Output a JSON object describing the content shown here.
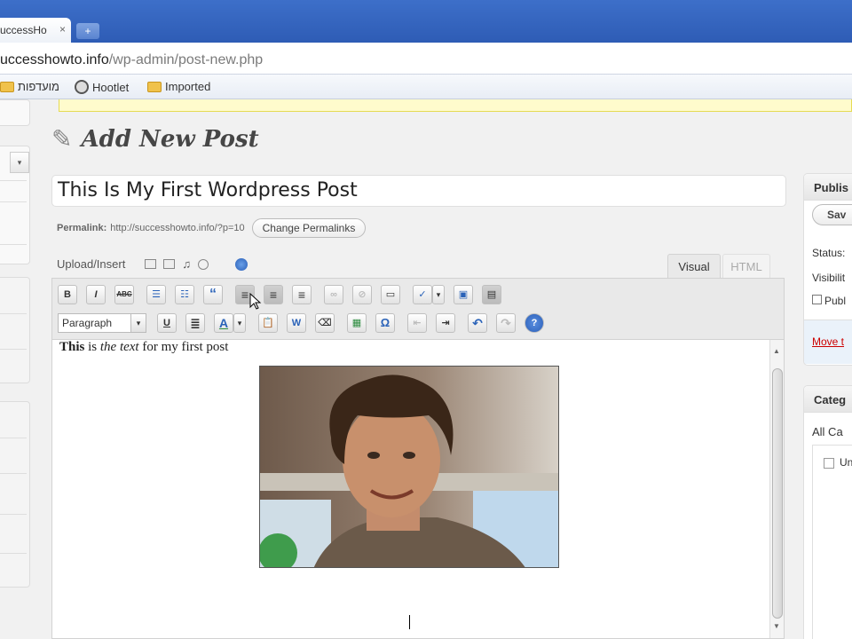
{
  "browser": {
    "tab_title": "uccessHo",
    "tab_close": "×",
    "new_tab": "+",
    "url_host": "uccesshowto.info",
    "url_path": "/wp-admin/post-new.php",
    "bookmarks": [
      {
        "label": "מועדפות",
        "icon": "folder-icon"
      },
      {
        "label": "Hootlet",
        "icon": "globe-icon"
      },
      {
        "label": "Imported",
        "icon": "folder-icon"
      }
    ]
  },
  "page": {
    "title": "Add New Post",
    "post_title_value": "This Is My First Wordpress Post",
    "permalink_label": "Permalink:",
    "permalink_url": "http://successhowto.info/?p=10",
    "change_permalinks": "Change Permalinks",
    "upload_insert": "Upload/Insert"
  },
  "editor": {
    "tab_visual": "Visual",
    "tab_html": "HTML",
    "format_value": "Paragraph",
    "text": {
      "bold": "This",
      "normal1": " is ",
      "italic": "the text",
      "normal2": " for my first post"
    },
    "row1": [
      {
        "id": "bold",
        "glyph": "B"
      },
      {
        "id": "italic",
        "glyph": "I"
      },
      {
        "id": "strikethrough",
        "glyph": "ABC"
      },
      {
        "id": "bullet-list",
        "glyph": "☰"
      },
      {
        "id": "numbered-list",
        "glyph": "☷"
      },
      {
        "id": "blockquote",
        "glyph": "“"
      },
      {
        "id": "align-left",
        "glyph": "≡"
      },
      {
        "id": "align-center",
        "glyph": "≡"
      },
      {
        "id": "align-right",
        "glyph": "≡"
      },
      {
        "id": "insert-link",
        "glyph": "∞"
      },
      {
        "id": "unlink",
        "glyph": "⊘"
      },
      {
        "id": "more-tag",
        "glyph": "▭"
      },
      {
        "id": "spellcheck",
        "glyph": "✓"
      },
      {
        "id": "spellcheck-menu",
        "glyph": "▾"
      },
      {
        "id": "fullscreen",
        "glyph": "▣"
      },
      {
        "id": "kitchen-sink",
        "glyph": "▤"
      }
    ],
    "row2": [
      {
        "id": "format-caret",
        "glyph": "▾"
      },
      {
        "id": "underline",
        "glyph": "U"
      },
      {
        "id": "justify",
        "glyph": "≣"
      },
      {
        "id": "text-color",
        "glyph": "A"
      },
      {
        "id": "text-color-menu",
        "glyph": "▾"
      },
      {
        "id": "paste-text",
        "glyph": "📋"
      },
      {
        "id": "paste-word",
        "glyph": "W"
      },
      {
        "id": "remove-format",
        "glyph": "⌫"
      },
      {
        "id": "insert-media",
        "glyph": "▦"
      },
      {
        "id": "special-char",
        "glyph": "Ω"
      },
      {
        "id": "outdent",
        "glyph": "⇤"
      },
      {
        "id": "indent",
        "glyph": "⇥"
      },
      {
        "id": "undo",
        "glyph": "↶"
      },
      {
        "id": "redo",
        "glyph": "↷"
      },
      {
        "id": "help",
        "glyph": "?"
      }
    ]
  },
  "sidebar": {
    "publish_head": "Publis",
    "save_draft": "Sav",
    "status": "Status:",
    "visibility": "Visibilit",
    "publish_date": "Publ",
    "move_trash": "Move t",
    "categories_head": "Categ",
    "all_categories": "All Ca",
    "uncategorized": "Un"
  },
  "colors": {
    "chrome_blue": "#2e5cb5",
    "notice_yellow": "#fffbcc",
    "trash_red": "#cc0000"
  }
}
